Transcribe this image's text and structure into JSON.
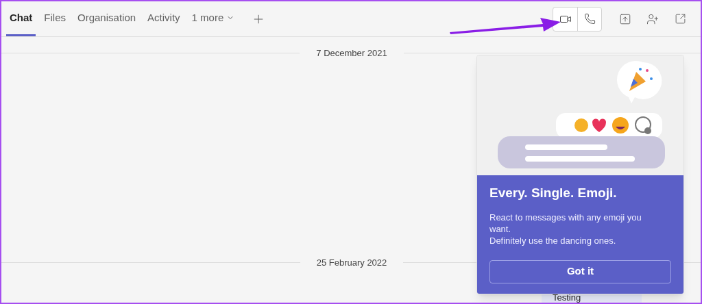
{
  "tabs": [
    {
      "label": "Chat",
      "selected": true
    },
    {
      "label": "Files",
      "selected": false
    },
    {
      "label": "Organisation",
      "selected": false
    },
    {
      "label": "Activity",
      "selected": false
    }
  ],
  "more_tab": {
    "label": "1 more"
  },
  "date_dividers": [
    "7 December 2021",
    "25 February 2022"
  ],
  "message": {
    "text": "Testing"
  },
  "popup": {
    "title": "Every. Single. Emoji.",
    "body_lines": [
      "React to messages with any emoji you want.",
      "Definitely use the dancing ones."
    ],
    "button": "Got it"
  }
}
